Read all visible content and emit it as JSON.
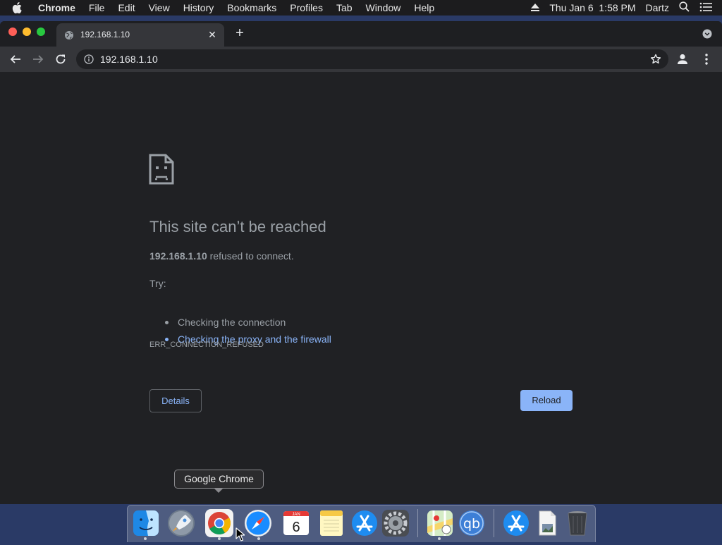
{
  "menubar": {
    "app_name": "Chrome",
    "items": [
      "File",
      "Edit",
      "View",
      "History",
      "Bookmarks",
      "Profiles",
      "Tab",
      "Window",
      "Help"
    ],
    "clock": "Thu Jan 6  1:58 PM",
    "user": "Dartz"
  },
  "browser": {
    "tab_title": "192.168.1.10",
    "url": "192.168.1.10"
  },
  "error_page": {
    "title": "This site can’t be reached",
    "host": "192.168.1.10",
    "message": " refused to connect.",
    "try_label": "Try:",
    "suggestions": [
      "Checking the connection",
      "Checking the proxy and the firewall"
    ],
    "error_code": "ERR_CONNECTION_REFUSED",
    "details_label": "Details",
    "reload_label": "Reload"
  },
  "dock": {
    "tooltip": "Google Chrome",
    "calendar_month": "JAN",
    "calendar_day": "6",
    "qbittorrent_label": "qb",
    "apps": [
      "Finder",
      "Launchpad",
      "Google Chrome",
      "Safari",
      "Calendar",
      "Notes",
      "App Store",
      "System Preferences",
      "Maps",
      "qBittorrent",
      "App Store",
      "Preview",
      "Trash"
    ]
  },
  "colors": {
    "page_bg": "#202124",
    "link": "#8ab4f8",
    "text_secondary": "#9aa0a6",
    "toolbar": "#35363a"
  }
}
